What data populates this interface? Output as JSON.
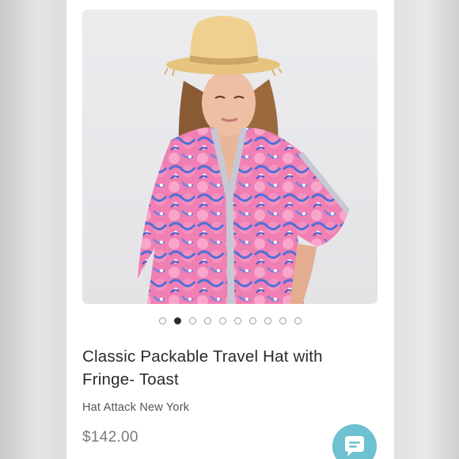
{
  "listing": {
    "title": "Classic Packable Travel Hat with Fringe- Toast",
    "brand": "Hat Attack New York",
    "price": "$142.00"
  },
  "gallery": {
    "image_count": 10,
    "active_index": 1
  },
  "chat": {
    "icon": "chat-bubble-icon",
    "color": "#6ec1d1"
  }
}
